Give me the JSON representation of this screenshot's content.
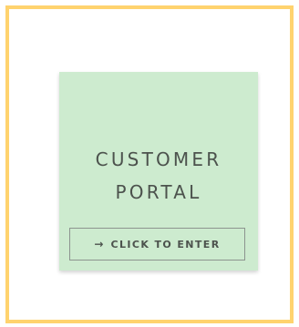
{
  "card": {
    "title_line_1": "CUSTOMER",
    "title_line_2": "PORTAL",
    "button_icon": "arrow-right-icon",
    "button_label": "CLICK TO ENTER"
  },
  "colors": {
    "frame_border": "#ffd36e",
    "card_background": "#cdebcf",
    "text": "#4c524d",
    "button_border": "#8c948f"
  }
}
